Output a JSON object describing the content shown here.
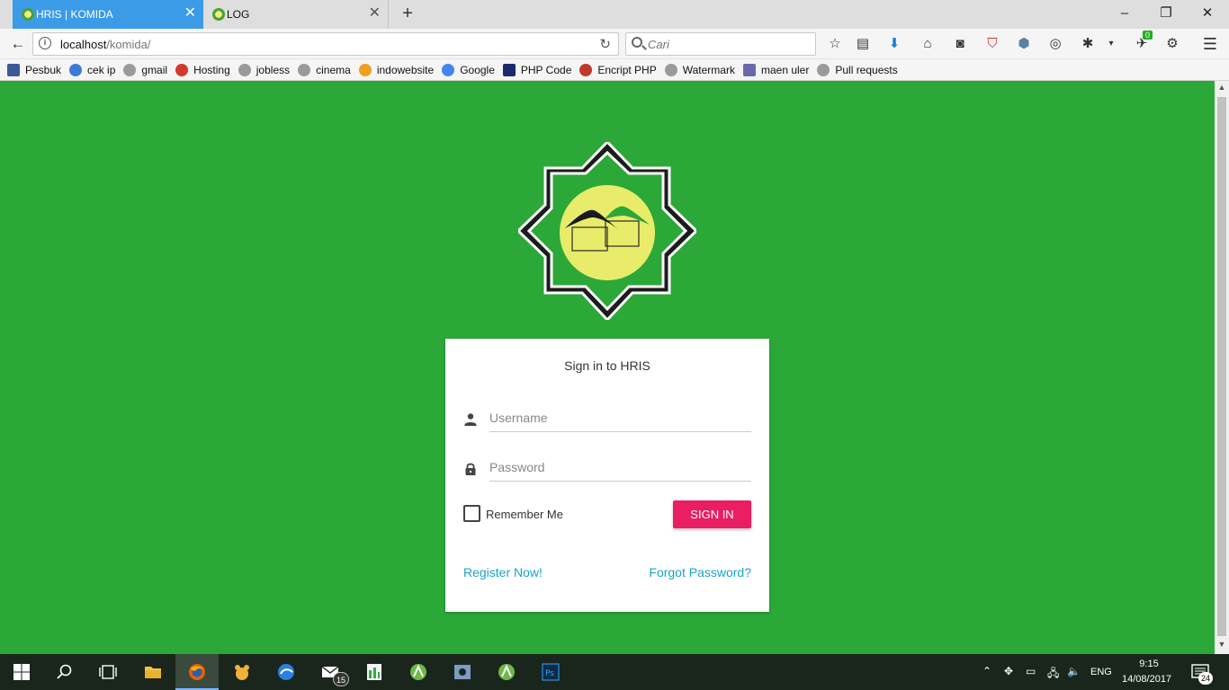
{
  "browser": {
    "tabs": [
      {
        "label": "HRIS | KOMIDA",
        "active": true
      },
      {
        "label": "LOG",
        "active": false
      }
    ],
    "url": {
      "host": "localhost",
      "path": "/komida/"
    },
    "search_placeholder": "Cari",
    "addon_badge": "0",
    "bookmarks": [
      {
        "label": "Pesbuk",
        "icon": "facebook-icon",
        "color": "#3b5998"
      },
      {
        "label": "cek ip",
        "icon": "globe-icon",
        "color": "#3a7bd5"
      },
      {
        "label": "gmail",
        "icon": "globe-icon",
        "color": "#9a9a9a"
      },
      {
        "label": "Hosting",
        "icon": "hosting-icon",
        "color": "#d33a2c"
      },
      {
        "label": "jobless",
        "icon": "globe-icon",
        "color": "#9a9a9a"
      },
      {
        "label": "cinema",
        "icon": "globe-icon",
        "color": "#9a9a9a"
      },
      {
        "label": "indowebsite",
        "icon": "indowebsite-icon",
        "color": "#f0a020"
      },
      {
        "label": "Google",
        "icon": "google-icon",
        "color": "#4285f4"
      },
      {
        "label": "PHP Code",
        "icon": "php-icon",
        "color": "#1a2a6c"
      },
      {
        "label": "Encript PHP",
        "icon": "cube-icon",
        "color": "#c0392b"
      },
      {
        "label": "Watermark",
        "icon": "globe-icon",
        "color": "#9a9a9a"
      },
      {
        "label": "maen uler",
        "icon": "snake-icon",
        "color": "#6a6aaa"
      },
      {
        "label": "Pull requests",
        "icon": "globe-icon",
        "color": "#9a9a9a"
      }
    ]
  },
  "login": {
    "title": "Sign in to HRIS",
    "username_placeholder": "Username",
    "password_placeholder": "Password",
    "remember_label": "Remember Me",
    "signin_label": "SIGN IN",
    "register_link": "Register Now!",
    "forgot_link": "Forgot Password?"
  },
  "taskbar": {
    "mail_badge": "15",
    "language": "ENG",
    "time": "9:15",
    "date": "14/08/2017",
    "notification_count": "24"
  },
  "colors": {
    "page_background": "#2ba838",
    "signin_button": "#e91e63",
    "link": "#1aa3c9",
    "logo_circle": "#e8ec6a",
    "active_tab": "#3b9be6"
  }
}
